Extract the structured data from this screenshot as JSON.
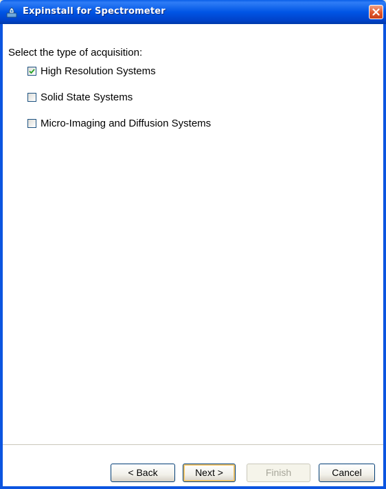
{
  "window": {
    "title": "Expinstall for Spectrometer"
  },
  "content": {
    "prompt": "Select the type of acquisition:",
    "options": [
      {
        "label": "High Resolution Systems",
        "checked": true
      },
      {
        "label": "Solid State Systems",
        "checked": false
      },
      {
        "label": "Micro-Imaging and Diffusion Systems",
        "checked": false
      }
    ]
  },
  "footer": {
    "back_label": "< Back",
    "next_label": "Next >",
    "finish_label": "Finish",
    "cancel_label": "Cancel"
  },
  "icons": {
    "app": "app-icon",
    "close": "close-icon",
    "check": "checkmark-icon"
  },
  "colors": {
    "titlebar": "#0055e5",
    "close_button": "#e2572b",
    "checkmark": "#21a121",
    "default_button_highlight": "#f1c56b"
  }
}
